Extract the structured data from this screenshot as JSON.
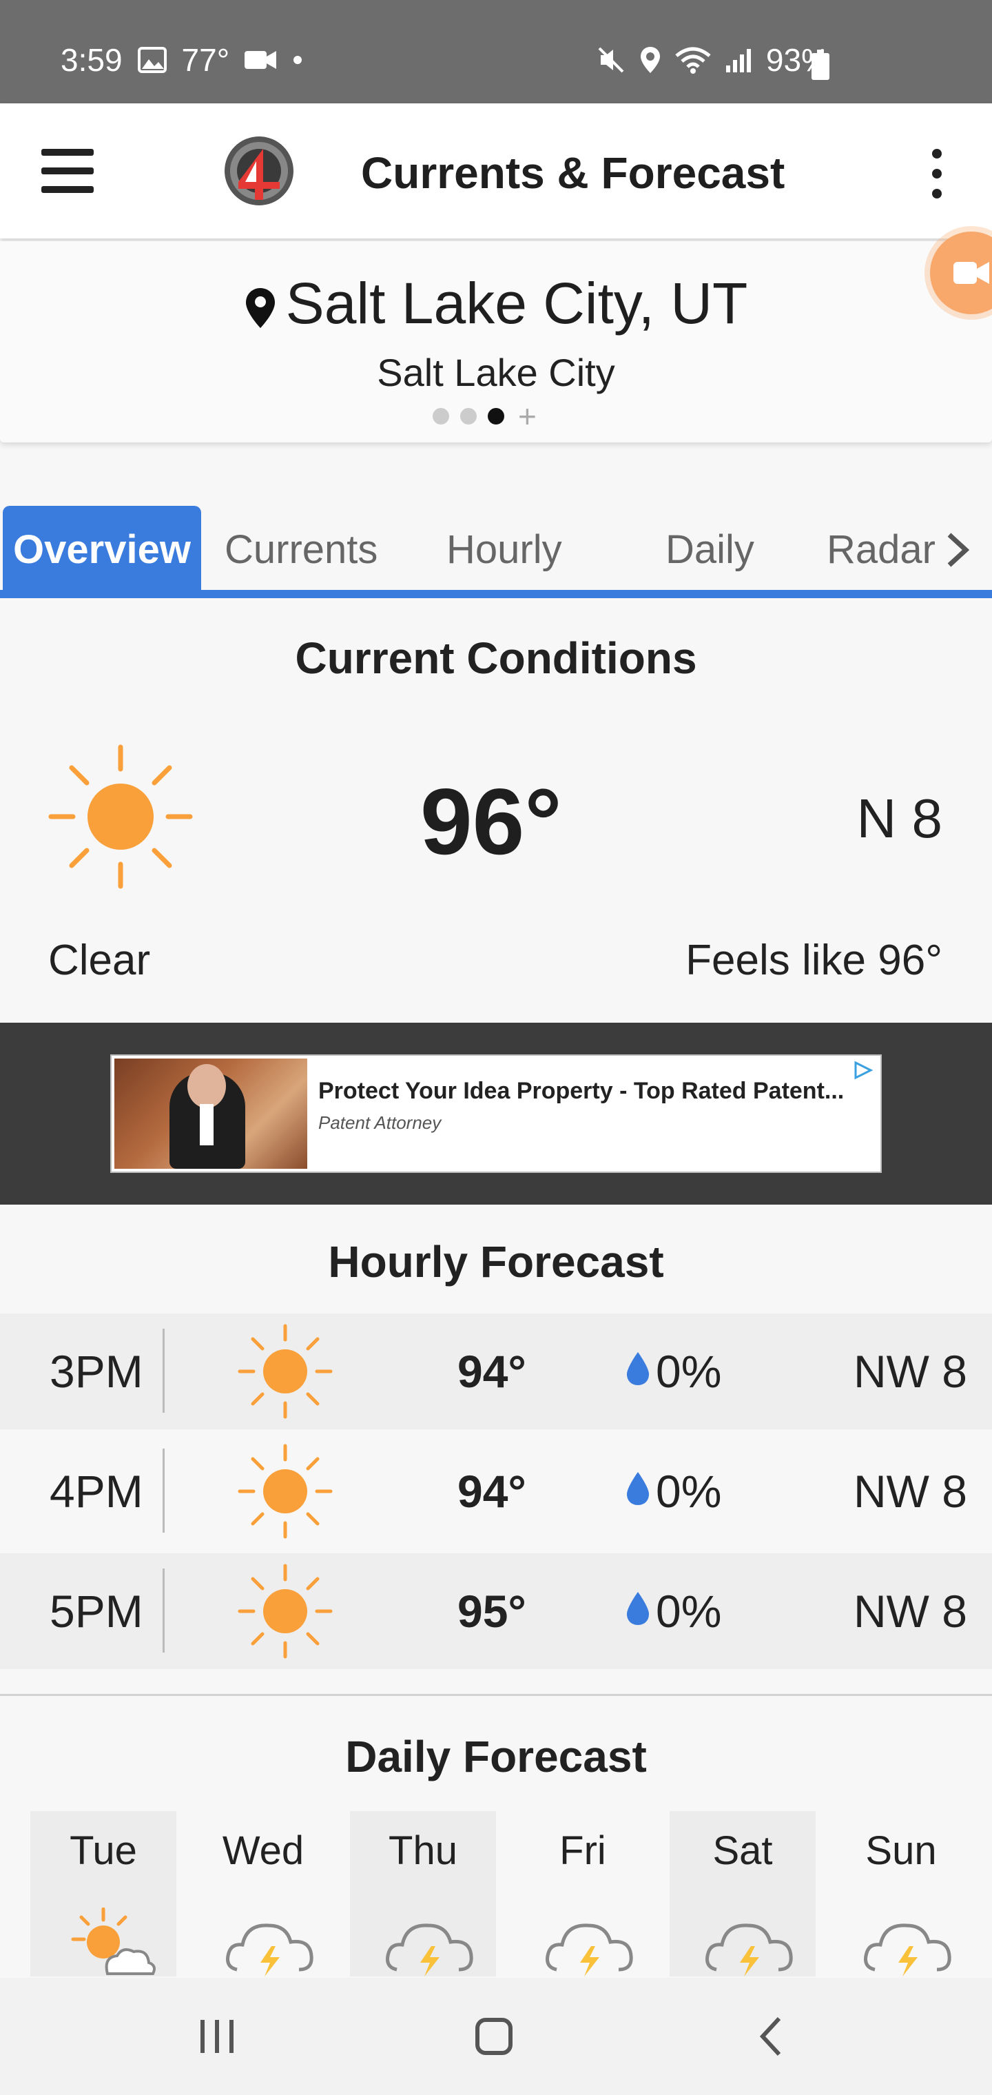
{
  "status_bar": {
    "time": "3:59",
    "temp": "77°",
    "battery": "93%"
  },
  "app_bar": {
    "title": "Currents & Forecast"
  },
  "location": {
    "name": "Salt Lake City, UT",
    "subtitle": "Salt Lake City",
    "page_dots": 3,
    "active_dot": 3
  },
  "tabs": [
    "Overview",
    "Currents",
    "Hourly",
    "Daily",
    "Radar"
  ],
  "current": {
    "section_title": "Current Conditions",
    "temp": "96°",
    "wind": "N  8",
    "condition": "Clear",
    "feels_like": "Feels like 96°",
    "icon": "sun-icon"
  },
  "ad": {
    "title": "Protect Your Idea Property - Top Rated Patent...",
    "subtitle": "Patent Attorney"
  },
  "hourly": {
    "section_title": "Hourly Forecast",
    "rows": [
      {
        "time": "3PM",
        "temp": "94°",
        "precip": "0%",
        "wind": "NW  8",
        "icon": "sun-icon"
      },
      {
        "time": "4PM",
        "temp": "94°",
        "precip": "0%",
        "wind": "NW  8",
        "icon": "sun-icon"
      },
      {
        "time": "5PM",
        "temp": "95°",
        "precip": "0%",
        "wind": "NW  8",
        "icon": "sun-icon"
      }
    ]
  },
  "daily": {
    "section_title": "Daily Forecast",
    "days": [
      {
        "name": "Tue",
        "icon": "partly-cloudy-icon"
      },
      {
        "name": "Wed",
        "icon": "thunderstorm-icon"
      },
      {
        "name": "Thu",
        "icon": "thunderstorm-icon"
      },
      {
        "name": "Fri",
        "icon": "thunderstorm-icon"
      },
      {
        "name": "Sat",
        "icon": "thunderstorm-icon"
      },
      {
        "name": "Sun",
        "icon": "thunderstorm-icon"
      }
    ]
  },
  "colors": {
    "accent": "#3a7bde",
    "sun": "#f9a03a",
    "drop": "#3a7bde",
    "status_bar": "#6d6d6d"
  }
}
